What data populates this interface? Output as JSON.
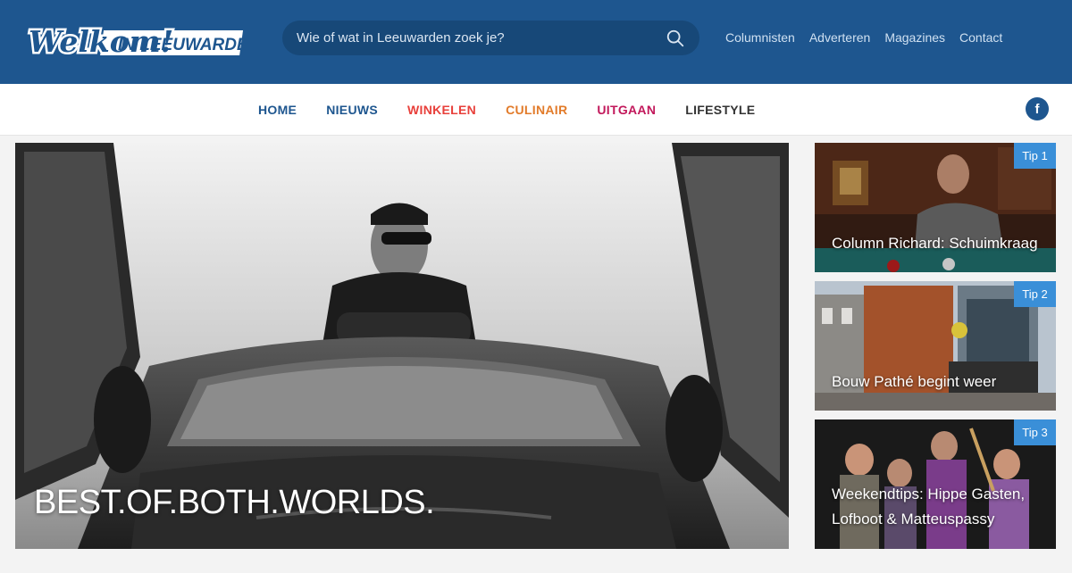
{
  "header": {
    "logo_text_1": "Welkom!",
    "logo_text_2": "IN LEEUWARDEN",
    "search_placeholder": "Wie of wat in Leeuwarden zoek je?",
    "links": [
      "Columnisten",
      "Adverteren",
      "Magazines",
      "Contact"
    ]
  },
  "nav": {
    "items": [
      {
        "label": "HOME",
        "color": "#1e568f"
      },
      {
        "label": "NIEUWS",
        "color": "#1e568f"
      },
      {
        "label": "WINKELEN",
        "color": "#e8403b"
      },
      {
        "label": "CULINAIR",
        "color": "#e27b2a"
      },
      {
        "label": "UITGAAN",
        "color": "#c2185b"
      },
      {
        "label": "LIFESTYLE",
        "color": "#333333"
      }
    ],
    "social_icon": "facebook-icon",
    "social_glyph": "f"
  },
  "hero": {
    "title": "BEST.OF.BOTH.WORLDS."
  },
  "tips": [
    {
      "badge": "Tip 1",
      "title_lines": [
        "Column Richard: Schuimkraag"
      ]
    },
    {
      "badge": "Tip 2",
      "title_lines": [
        "Bouw Pathé begint weer"
      ]
    },
    {
      "badge": "Tip 3",
      "title_lines": [
        "Weekendtips: Hippe Gasten,",
        "Lofboot & Matteuspassy"
      ]
    }
  ],
  "colors": {
    "header_bg": "#1e568f",
    "search_bg": "#174878",
    "tip_badge": "#3a8fd8"
  }
}
